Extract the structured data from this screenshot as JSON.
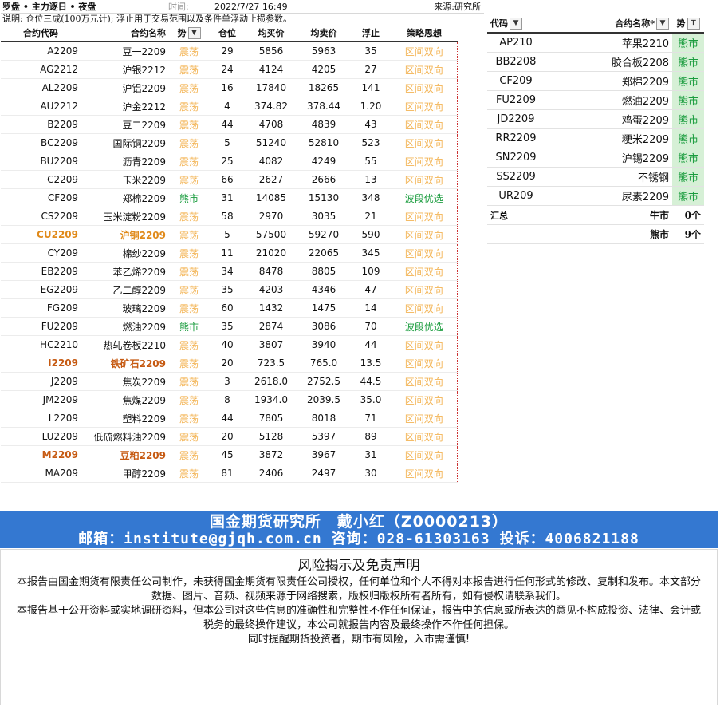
{
  "header": {
    "title": "罗盘 • 主力逐日 • 夜盘",
    "time_label": "时间:",
    "time_value": "2022/7/27 16:49",
    "source": "来源:研究所",
    "note": "说明: 仓位三成(100万元计); 浮止用于交易范围以及条件单浮动止损参数。"
  },
  "main_table": {
    "columns": [
      "合约代码",
      "合约名称",
      "势",
      "仓位",
      "均买价",
      "均卖价",
      "浮止",
      "策略思想"
    ],
    "rows": [
      {
        "code": "A2209",
        "name": "豆一2209",
        "trend": "震荡",
        "pos": "29",
        "buy": "5856",
        "sell": "5963",
        "stop": "35",
        "strategy": "区间双向"
      },
      {
        "code": "AG2212",
        "name": "沪银2212",
        "trend": "震荡",
        "pos": "24",
        "buy": "4124",
        "sell": "4205",
        "stop": "27",
        "strategy": "区间双向"
      },
      {
        "code": "AL2209",
        "name": "沪铝2209",
        "trend": "震荡",
        "pos": "16",
        "buy": "17840",
        "sell": "18265",
        "stop": "141",
        "strategy": "区间双向"
      },
      {
        "code": "AU2212",
        "name": "沪金2212",
        "trend": "震荡",
        "pos": "4",
        "buy": "374.82",
        "sell": "378.44",
        "stop": "1.20",
        "strategy": "区间双向"
      },
      {
        "code": "B2209",
        "name": "豆二2209",
        "trend": "震荡",
        "pos": "44",
        "buy": "4708",
        "sell": "4839",
        "stop": "43",
        "strategy": "区间双向"
      },
      {
        "code": "BC2209",
        "name": "国际铜2209",
        "trend": "震荡",
        "pos": "5",
        "buy": "51240",
        "sell": "52810",
        "stop": "523",
        "strategy": "区间双向"
      },
      {
        "code": "BU2209",
        "name": "沥青2209",
        "trend": "震荡",
        "pos": "25",
        "buy": "4082",
        "sell": "4249",
        "stop": "55",
        "strategy": "区间双向"
      },
      {
        "code": "C2209",
        "name": "玉米2209",
        "trend": "震荡",
        "pos": "66",
        "buy": "2627",
        "sell": "2666",
        "stop": "13",
        "strategy": "区间双向"
      },
      {
        "code": "CF209",
        "name": "郑棉2209",
        "trend": "熊市",
        "pos": "31",
        "buy": "14085",
        "sell": "15130",
        "stop": "348",
        "strategy": "波段优选"
      },
      {
        "code": "CS2209",
        "name": "玉米淀粉2209",
        "trend": "震荡",
        "pos": "58",
        "buy": "2970",
        "sell": "3035",
        "stop": "21",
        "strategy": "区间双向"
      },
      {
        "code": "CU2209",
        "name": "沪铜2209",
        "trend": "震荡",
        "pos": "5",
        "buy": "57500",
        "sell": "59270",
        "stop": "590",
        "strategy": "区间双向"
      },
      {
        "code": "CY209",
        "name": "棉纱2209",
        "trend": "震荡",
        "pos": "11",
        "buy": "21020",
        "sell": "22065",
        "stop": "345",
        "strategy": "区间双向"
      },
      {
        "code": "EB2209",
        "name": "苯乙烯2209",
        "trend": "震荡",
        "pos": "34",
        "buy": "8478",
        "sell": "8805",
        "stop": "109",
        "strategy": "区间双向"
      },
      {
        "code": "EG2209",
        "name": "乙二醇2209",
        "trend": "震荡",
        "pos": "35",
        "buy": "4203",
        "sell": "4346",
        "stop": "47",
        "strategy": "区间双向"
      },
      {
        "code": "FG209",
        "name": "玻璃2209",
        "trend": "震荡",
        "pos": "60",
        "buy": "1432",
        "sell": "1475",
        "stop": "14",
        "strategy": "区间双向"
      },
      {
        "code": "FU2209",
        "name": "燃油2209",
        "trend": "熊市",
        "pos": "35",
        "buy": "2874",
        "sell": "3086",
        "stop": "70",
        "strategy": "波段优选"
      },
      {
        "code": "HC2210",
        "name": "热轧卷板2210",
        "trend": "震荡",
        "pos": "40",
        "buy": "3807",
        "sell": "3940",
        "stop": "44",
        "strategy": "区间双向"
      },
      {
        "code": "I2209",
        "name": "铁矿石2209",
        "trend": "震荡",
        "pos": "20",
        "buy": "723.5",
        "sell": "765.0",
        "stop": "13.5",
        "strategy": "区间双向"
      },
      {
        "code": "J2209",
        "name": "焦炭2209",
        "trend": "震荡",
        "pos": "3",
        "buy": "2618.0",
        "sell": "2752.5",
        "stop": "44.5",
        "strategy": "区间双向"
      },
      {
        "code": "JM2209",
        "name": "焦煤2209",
        "trend": "震荡",
        "pos": "8",
        "buy": "1934.0",
        "sell": "2039.5",
        "stop": "35.0",
        "strategy": "区间双向"
      },
      {
        "code": "L2209",
        "name": "塑料2209",
        "trend": "震荡",
        "pos": "44",
        "buy": "7805",
        "sell": "8018",
        "stop": "71",
        "strategy": "区间双向"
      },
      {
        "code": "LU2209",
        "name": "低硫燃料油2209",
        "trend": "震荡",
        "pos": "20",
        "buy": "5128",
        "sell": "5397",
        "stop": "89",
        "strategy": "区间双向"
      },
      {
        "code": "M2209",
        "name": "豆粕2209",
        "trend": "震荡",
        "pos": "45",
        "buy": "3872",
        "sell": "3967",
        "stop": "31",
        "strategy": "区间双向"
      },
      {
        "code": "MA209",
        "name": "甲醇2209",
        "trend": "震荡",
        "pos": "81",
        "buy": "2406",
        "sell": "2497",
        "stop": "30",
        "strategy": "区间双向"
      }
    ]
  },
  "side_table": {
    "columns": [
      "代码",
      "合约名称*",
      "势"
    ],
    "rows": [
      {
        "code": "AP210",
        "name": "苹果2210",
        "trend": "熊市"
      },
      {
        "code": "BB2208",
        "name": "胶合板2208",
        "trend": "熊市"
      },
      {
        "code": "CF209",
        "name": "郑棉2209",
        "trend": "熊市"
      },
      {
        "code": "FU2209",
        "name": "燃油2209",
        "trend": "熊市"
      },
      {
        "code": "JD2209",
        "name": "鸡蛋2209",
        "trend": "熊市"
      },
      {
        "code": "RR2209",
        "name": "粳米2209",
        "trend": "熊市"
      },
      {
        "code": "SN2209",
        "name": "沪锡2209",
        "trend": "熊市"
      },
      {
        "code": "SS2209",
        "name": "不锈钢",
        "trend": "熊市"
      },
      {
        "code": "UR209",
        "name": "尿素2209",
        "trend": "熊市"
      }
    ],
    "summary_label": "汇总",
    "summary": [
      {
        "label": "牛市",
        "value": "0个"
      },
      {
        "label": "熊市",
        "value": "9个"
      }
    ]
  },
  "banner": {
    "line1": "国金期货研究所　戴小红（Z0000213）",
    "line2": "邮箱：institute@gjqh.com.cn 咨询：028-61303163 投诉：4006821188"
  },
  "disclaimer": {
    "heading": "风险揭示及免责声明",
    "p1": "本报告由国金期货有限责任公司制作，未获得国金期货有限责任公司授权，任何单位和个人不得对本报告进行任何形式的修改、复制和发布。本文部分数据、图片、音频、视频来源于网络搜索，版权归版权所有者所有，如有侵权请联系我们。",
    "p2": "本报告基于公开资料或实地调研资料，但本公司对这些信息的准确性和完整性不作任何保证，报告中的信息或所表达的意见不构成投资、法律、会计或税务的最终操作建议，本公司就报告内容及最终操作不作任何担保。",
    "p3": "同时提醒期货投资者，期市有风险，入市需谨慎!"
  },
  "colors": {
    "range_trend": "#f3b455",
    "bear_trend": "#1a9c3e",
    "banner_bg": "#3478d1"
  }
}
